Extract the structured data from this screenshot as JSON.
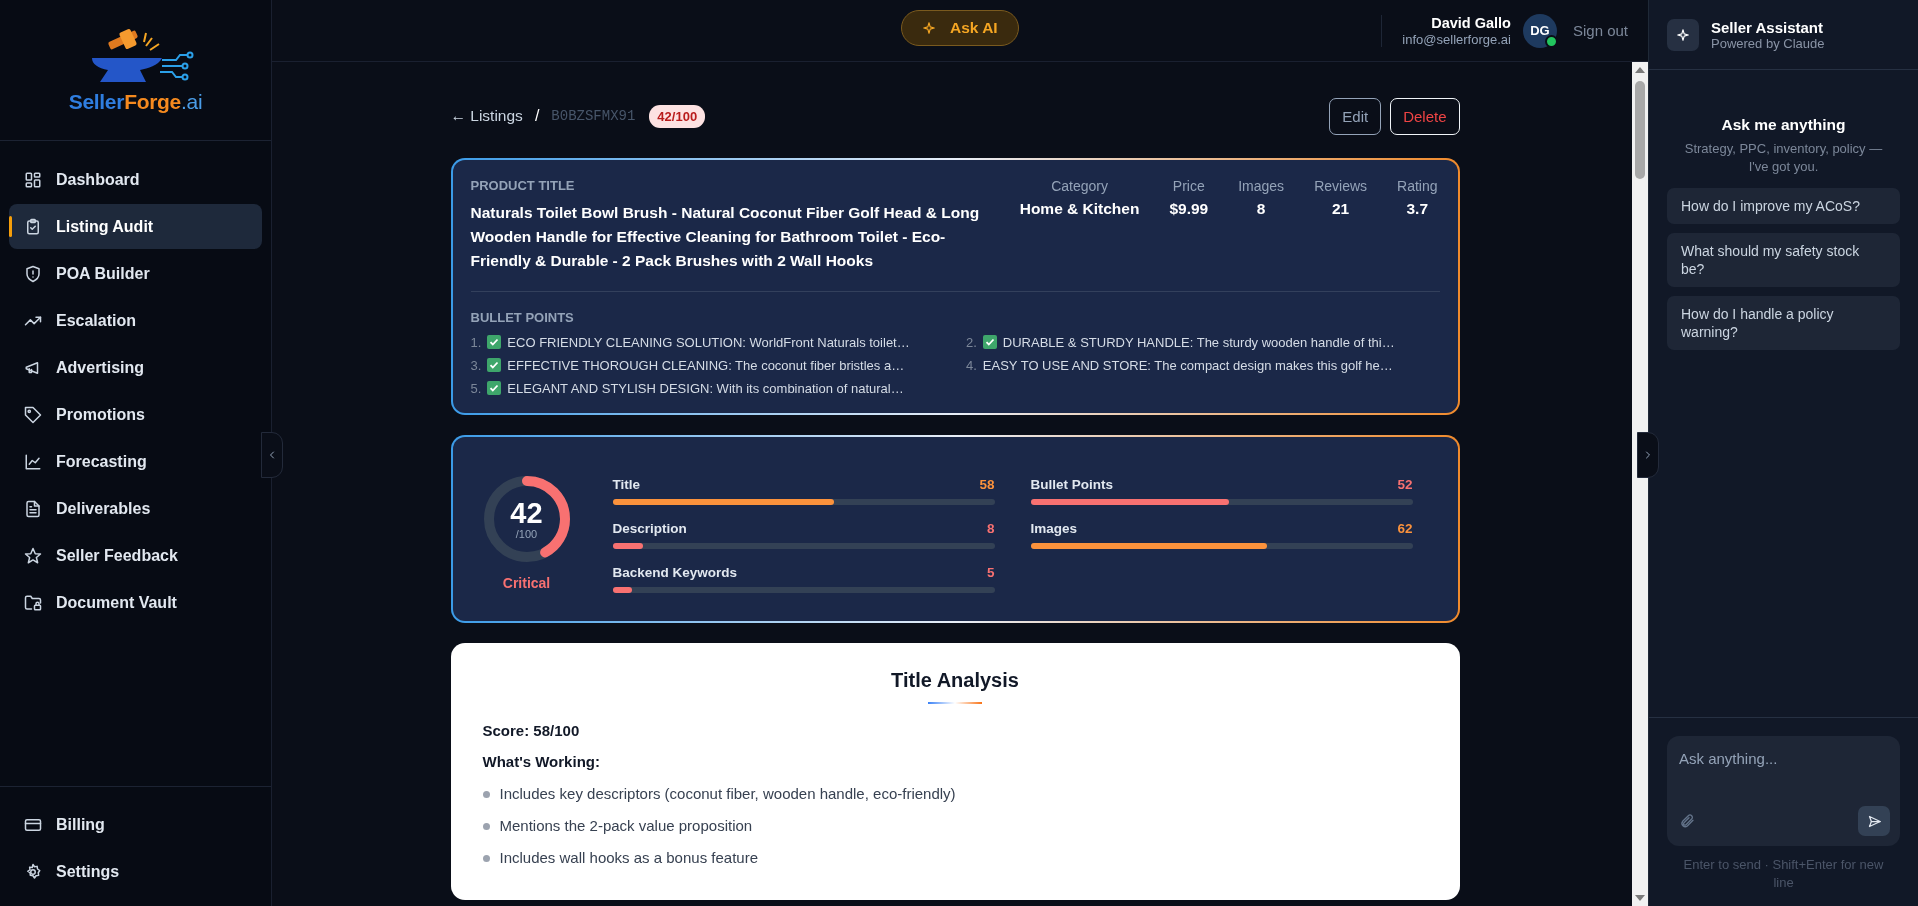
{
  "sidebar": {
    "logo_text": [
      "Seller",
      "Forge",
      ".ai"
    ],
    "items": [
      {
        "label": "Dashboard",
        "selected": false
      },
      {
        "label": "Listing Audit",
        "selected": true
      },
      {
        "label": "POA Builder",
        "selected": false
      },
      {
        "label": "Escalation",
        "selected": false
      },
      {
        "label": "Advertising",
        "selected": false
      },
      {
        "label": "Promotions",
        "selected": false
      },
      {
        "label": "Forecasting",
        "selected": false
      },
      {
        "label": "Deliverables",
        "selected": false
      },
      {
        "label": "Seller Feedback",
        "selected": false
      },
      {
        "label": "Document Vault",
        "selected": false
      }
    ],
    "bottom_items": [
      {
        "label": "Billing",
        "selected": false
      },
      {
        "label": "Settings",
        "selected": false
      }
    ]
  },
  "header": {
    "ask_ai": "Ask AI",
    "user": {
      "name": "David Gallo",
      "email": "info@sellerforge.ai",
      "initials": "DG",
      "online": true
    },
    "sign_out": "Sign out"
  },
  "breadcrumb": {
    "back": "← Listings",
    "separator": "/",
    "asin": "B0BZSFMX91",
    "score_badge": "42/100"
  },
  "actions": [
    "Edit",
    "Delete"
  ],
  "product": {
    "title_label": "PRODUCT TITLE",
    "title": "Naturals Toilet Bowl Brush - Natural Coconut Fiber Golf Head & Long Wooden Handle for Effective Cleaning for Bathroom Toilet - Eco-Friendly & Durable - 2 Pack Brushes with 2 Wall Hooks",
    "stats": [
      {
        "label": "Category",
        "value": "Home & Kitchen"
      },
      {
        "label": "Price",
        "value": "$9.99"
      },
      {
        "label": "Images",
        "value": "8"
      },
      {
        "label": "Reviews",
        "value": "21"
      },
      {
        "label": "Rating",
        "value": "3.7"
      }
    ],
    "bullets_label": "BULLET POINTS",
    "bullets": [
      {
        "number": "1.",
        "verified": true,
        "text": "ECO FRIENDLY CLEANING SOLUTION: WorldFront Naturals toilet…"
      },
      {
        "number": "2.",
        "verified": true,
        "text": "DURABLE & STURDY HANDLE: The sturdy wooden handle of thi…"
      },
      {
        "number": "3.",
        "verified": true,
        "text": "EFFECTIVE THOROUGH CLEANING: The coconut fiber bristles a…"
      },
      {
        "number": "4.",
        "verified": false,
        "text": "EASY TO USE AND STORE: The compact design makes this golf he…"
      },
      {
        "number": "5.",
        "verified": true,
        "text": "ELEGANT AND STYLISH DESIGN: With its combination of natural…"
      }
    ]
  },
  "scores": {
    "overall": {
      "value": "42",
      "max": "/100",
      "level": 0.42,
      "status": "Critical",
      "color": "#f87171"
    },
    "metrics": [
      {
        "label": "Title",
        "value": "58",
        "level": 0.58,
        "color": "#fb923c"
      },
      {
        "label": "Bullet Points",
        "value": "52",
        "level": 0.52,
        "color": "#f87171"
      },
      {
        "label": "Description",
        "value": "8",
        "level": 0.08,
        "color": "#f87171"
      },
      {
        "label": "Images",
        "value": "62",
        "level": 0.62,
        "color": "#fb923c"
      },
      {
        "label": "Backend Keywords",
        "value": "5",
        "level": 0.05,
        "color": "#f87171"
      }
    ]
  },
  "analysis": {
    "title": "Title Analysis",
    "score_line": "Score: 58/100",
    "section": "What's Working:",
    "items": [
      "Includes key descriptors (coconut fiber, wooden handle, eco-friendly)",
      "Mentions the 2-pack value proposition",
      "Includes wall hooks as a bonus feature"
    ]
  },
  "assistant": {
    "title": "Seller Assistant",
    "subtitle": "Powered by Claude",
    "heading": "Ask me anything",
    "subheading": "Strategy, PPC, inventory, policy — I've got you.",
    "suggestions": [
      "How do I improve my ACoS?",
      "What should my safety stock be?",
      "How do I handle a policy warning?"
    ],
    "placeholder": "Ask anything...",
    "hint": "Enter to send · Shift+Enter for new line"
  }
}
